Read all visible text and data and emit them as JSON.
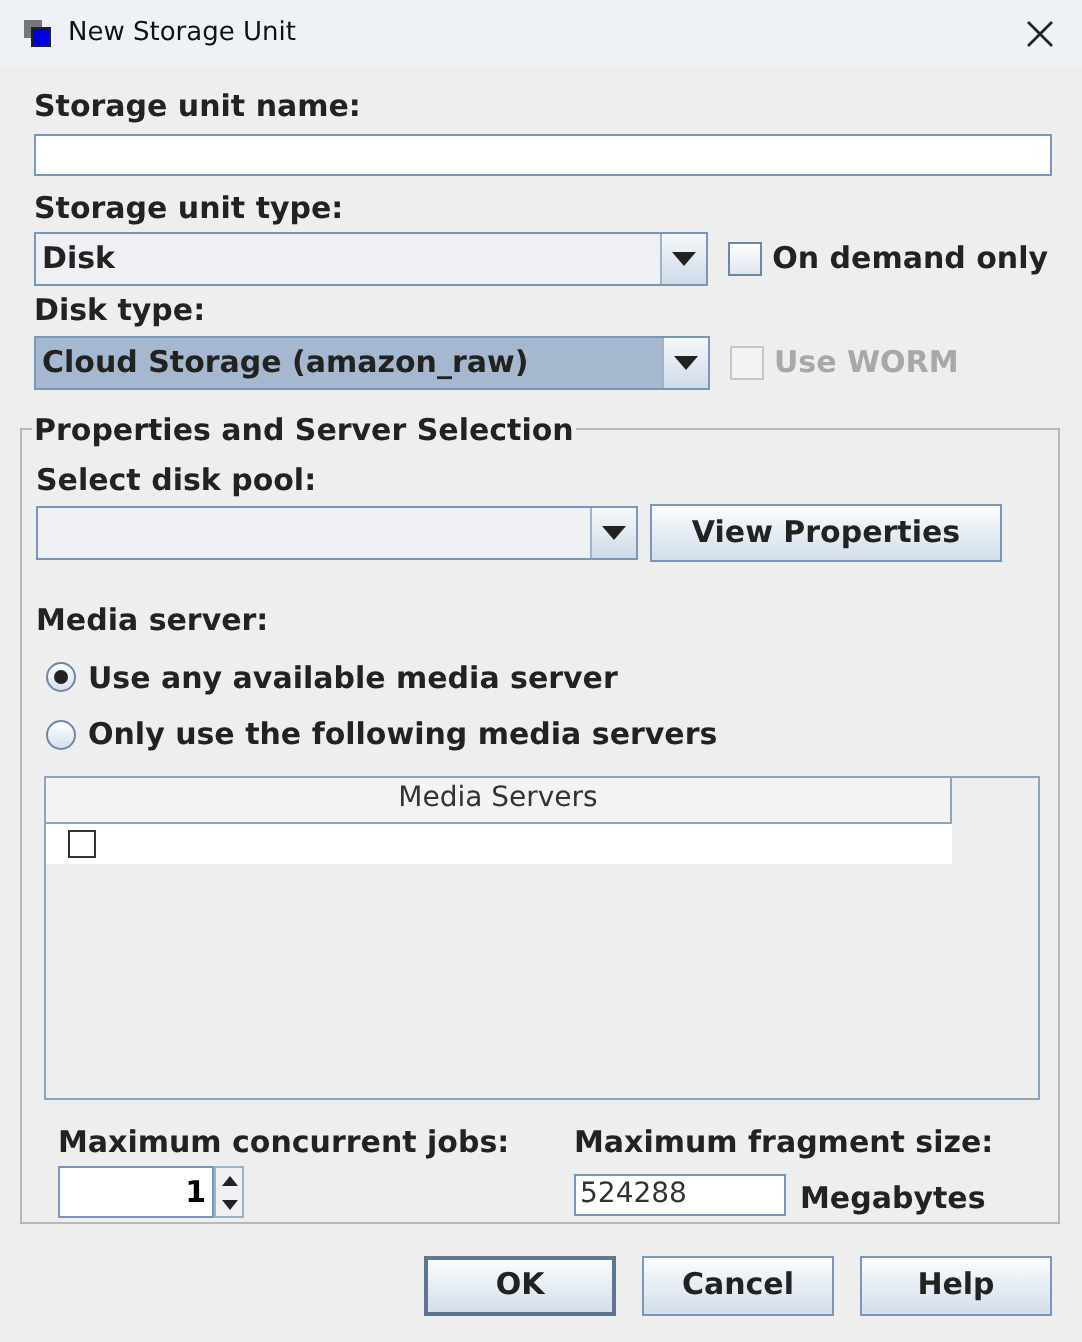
{
  "window": {
    "title": "New Storage Unit"
  },
  "storage_unit_name": {
    "label": "Storage unit name:"
  },
  "storage_unit_type": {
    "label": "Storage unit type:",
    "value": "Disk",
    "selected": false
  },
  "on_demand_only": {
    "label": "On demand only",
    "checked": false,
    "disabled": false
  },
  "disk_type": {
    "label": "Disk type:",
    "value": "Cloud Storage (amazon_raw)",
    "selected": true
  },
  "use_worm": {
    "label": "Use WORM",
    "checked": false,
    "disabled": true
  },
  "group": {
    "title": "Properties and Server Selection",
    "disk_pool": {
      "label": "Select disk pool:",
      "button": "View Properties"
    },
    "media_server": {
      "label": "Media server:",
      "options": [
        {
          "label": "Use any available media server",
          "selected": true
        },
        {
          "label": "Only use the following media servers",
          "selected": false
        }
      ]
    },
    "table": {
      "columns": [
        "Media Servers"
      ],
      "rows": [
        {
          "checked": false
        }
      ]
    },
    "max_jobs": {
      "label": "Maximum concurrent jobs:",
      "value": "1"
    },
    "max_fragment": {
      "label": "Maximum fragment size:",
      "value": "524288",
      "unit": "Megabytes"
    }
  },
  "buttons": [
    "OK",
    "Cancel",
    "Help"
  ]
}
